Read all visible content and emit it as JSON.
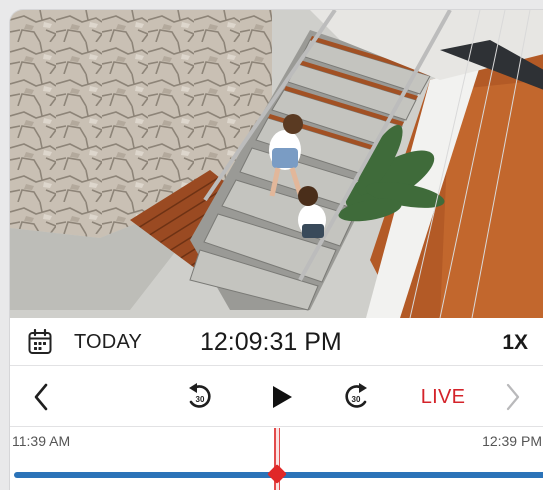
{
  "datebar": {
    "date_label": "TODAY",
    "time": "12:09:31 PM",
    "speed": "1X"
  },
  "controls": {
    "rewind_seconds": "30",
    "forward_seconds": "30",
    "live_label": "LIVE"
  },
  "timeline": {
    "start_label": "11:39 AM",
    "end_label": "12:39 PM",
    "position_fraction": 0.5
  },
  "colors": {
    "live": "#d4232a",
    "track": "#2b73b8",
    "cursor": "#e02828"
  }
}
